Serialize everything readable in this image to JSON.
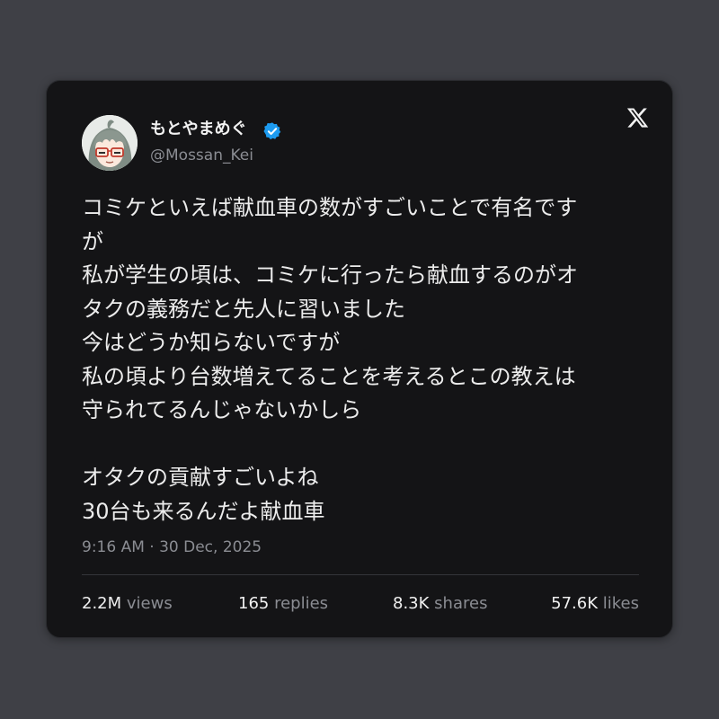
{
  "colors": {
    "background": "#3f4046",
    "card": "#141416",
    "text_primary": "#ececec",
    "text_secondary": "#8b8d93",
    "verified_badge": "#1d9bf0"
  },
  "author": {
    "display_name": "もとやまめぐ",
    "handle": "@Mossan_Kei",
    "avatar_icon": "avatar-illustration",
    "verified_icon": "verified-badge-icon"
  },
  "brand_icon": "x-logo-icon",
  "tweet": {
    "lines": [
      "コミケといえば献血車の数がすごいことで有名です",
      "が",
      "私が学生の頃は、コミケに行ったら献血するのがオ",
      "タクの義務だと先人に習いました",
      "今はどうか知らないですが",
      "私の頃より台数増えてることを考えるとこの教えは",
      "守られてるんじゃないかしら",
      "",
      "オタクの貢献すごいよね",
      "30台も来るんだよ献血車"
    ],
    "timestamp": "9:16 AM · 30 Dec, 2025"
  },
  "stats": {
    "views": {
      "value": "2.2M",
      "label": "views"
    },
    "replies": {
      "value": "165",
      "label": "replies"
    },
    "shares": {
      "value": "8.3K",
      "label": "shares"
    },
    "likes": {
      "value": "57.6K",
      "label": "likes"
    }
  }
}
